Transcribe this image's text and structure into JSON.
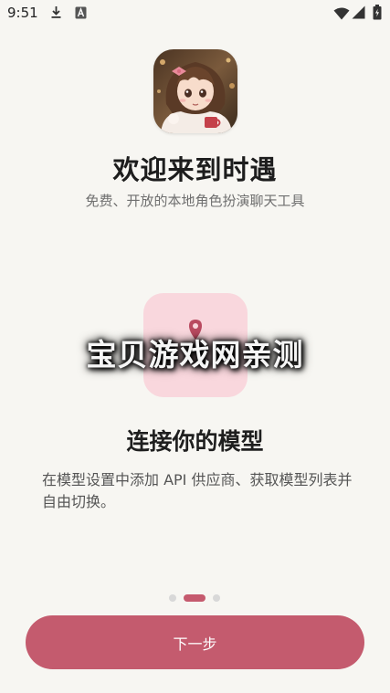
{
  "status_bar": {
    "time": "9:51",
    "icons": [
      "download-icon",
      "a-icon",
      "wifi-icon",
      "signal-icon",
      "battery-icon"
    ]
  },
  "welcome": {
    "title": "欢迎来到时遇",
    "subtitle": "免费、开放的本地角色扮演聊天工具"
  },
  "feature": {
    "icon": "location-pin-icon",
    "title": "连接你的模型",
    "description": "在模型设置中添加 API 供应商、获取模型列表并自由切换。"
  },
  "watermark": {
    "text": "宝贝游戏网亲测"
  },
  "pager": {
    "count": 3,
    "active_index": 1
  },
  "actions": {
    "next_label": "下一步"
  },
  "colors": {
    "accent": "#c45b6e",
    "icon_box": "#f9d7dd",
    "background": "#f7f6f2"
  }
}
